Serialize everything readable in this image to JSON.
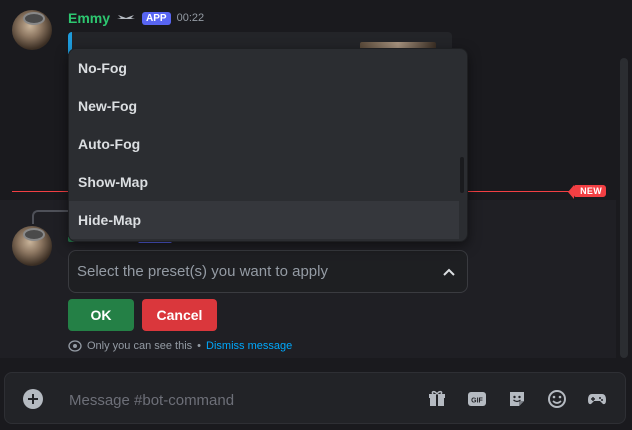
{
  "message": {
    "username": "Emmy",
    "app_badge": "APP",
    "timestamp": "00:22"
  },
  "new_divider": {
    "label": "NEW"
  },
  "dropdown": {
    "options": [
      "No-Fog",
      "New-Fog",
      "Auto-Fog",
      "Show-Map",
      "Hide-Map"
    ]
  },
  "select": {
    "placeholder": "Select the preset(s) you want to apply"
  },
  "buttons": {
    "ok": "OK",
    "cancel": "Cancel"
  },
  "ephemeral": {
    "text": "Only you can see this",
    "separator": "•",
    "dismiss": "Dismiss message"
  },
  "composer": {
    "placeholder": "Message #bot-command"
  },
  "icons": {
    "add": "plus-circle-icon",
    "gift": "gift-icon",
    "gif": "gif-icon",
    "sticker": "sticker-icon",
    "emoji": "emoji-icon",
    "activity": "gamepad-icon"
  },
  "colors": {
    "username": "#2dc770",
    "app_badge": "#5865f2",
    "ok_button": "#248046",
    "cancel_button": "#da373c",
    "new_divider": "#f23f43",
    "link": "#00a8fc"
  }
}
